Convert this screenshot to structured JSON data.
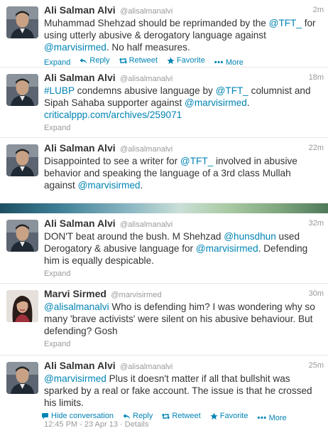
{
  "tweets": [
    {
      "name": "Ali Salman Alvi",
      "handle": "@alisalmanalvi",
      "time": "2m",
      "text_parts": [
        {
          "t": "Muhammad Shehzad should be reprimanded by the ",
          "link": false
        },
        {
          "t": "@TFT_",
          "link": true
        },
        {
          "t": " for using utterly abusive & derogatory language against ",
          "link": false
        },
        {
          "t": "@marvisirmed",
          "link": true
        },
        {
          "t": ". No half measures.",
          "link": false
        }
      ],
      "actions": [
        "Expand",
        "Reply",
        "Retweet",
        "Favorite",
        "More"
      ]
    },
    {
      "name": "Ali Salman Alvi",
      "handle": "@alisalmanalvi",
      "time": "18m",
      "text_parts": [
        {
          "t": "#LUBP",
          "link": true
        },
        {
          "t": " condemns abusive language by ",
          "link": false
        },
        {
          "t": "@TFT_",
          "link": true
        },
        {
          "t": "  columnist and Sipah Sahaba supporter against ",
          "link": false
        },
        {
          "t": "@marvisirmed",
          "link": true
        },
        {
          "t": ". ",
          "link": false
        },
        {
          "t": "criticalppp.com/archives/259071",
          "link": true
        }
      ],
      "actions": [
        "Expand"
      ]
    },
    {
      "name": "Ali Salman Alvi",
      "handle": "@alisalmanalvi",
      "time": "22m",
      "text_parts": [
        {
          "t": "Disappointed to see a writer for ",
          "link": false
        },
        {
          "t": "@TFT_",
          "link": true
        },
        {
          "t": " involved in abusive behavior and speaking the language of a 3rd class Mullah against ",
          "link": false
        },
        {
          "t": "@marvisirmed",
          "link": true
        },
        {
          "t": ".",
          "link": false
        }
      ],
      "actions": []
    },
    {
      "name": "Ali Salman Alvi",
      "handle": "@alisalmanalvi",
      "time": "32m",
      "text_parts": [
        {
          "t": "DON'T beat around the bush. M Shehzad ",
          "link": false
        },
        {
          "t": "@hunsdhun",
          "link": true
        },
        {
          "t": " used Derogatory & abusive language for ",
          "link": false
        },
        {
          "t": "@marvisirmed",
          "link": true
        },
        {
          "t": ". Defending him is equally despicable.",
          "link": false
        }
      ],
      "actions": [
        "Expand"
      ]
    },
    {
      "name": "Marvi Sirmed",
      "handle": "@marvisirmed",
      "time": "30m",
      "text_parts": [
        {
          "t": "@alisalmanalvi",
          "link": true
        },
        {
          "t": " Who is defending him? I was wondering why so many 'brave activists' were silent on his abusive behaviour. But defending? Gosh",
          "link": false
        }
      ],
      "actions": [
        "Expand"
      ]
    },
    {
      "name": "Ali Salman Alvi",
      "handle": "@alisalmanalvi",
      "time": "25m",
      "text_parts": [
        {
          "t": "@marvisirmed",
          "link": true
        },
        {
          "t": " Plus it doesn't matter if all that bullshit was sparked by a real or fake account. The issue is that he crossed his limits.",
          "link": false
        }
      ],
      "actions": [
        "Hide conversation",
        "Reply",
        "Retweet",
        "Favorite",
        "More"
      ]
    }
  ],
  "footer": {
    "timestamp": "12:45 PM - 23 Apr 13",
    "separator": "·",
    "details": "Details"
  },
  "colors": {
    "link": "#0084b4",
    "muted": "#999999",
    "text": "#333333"
  }
}
